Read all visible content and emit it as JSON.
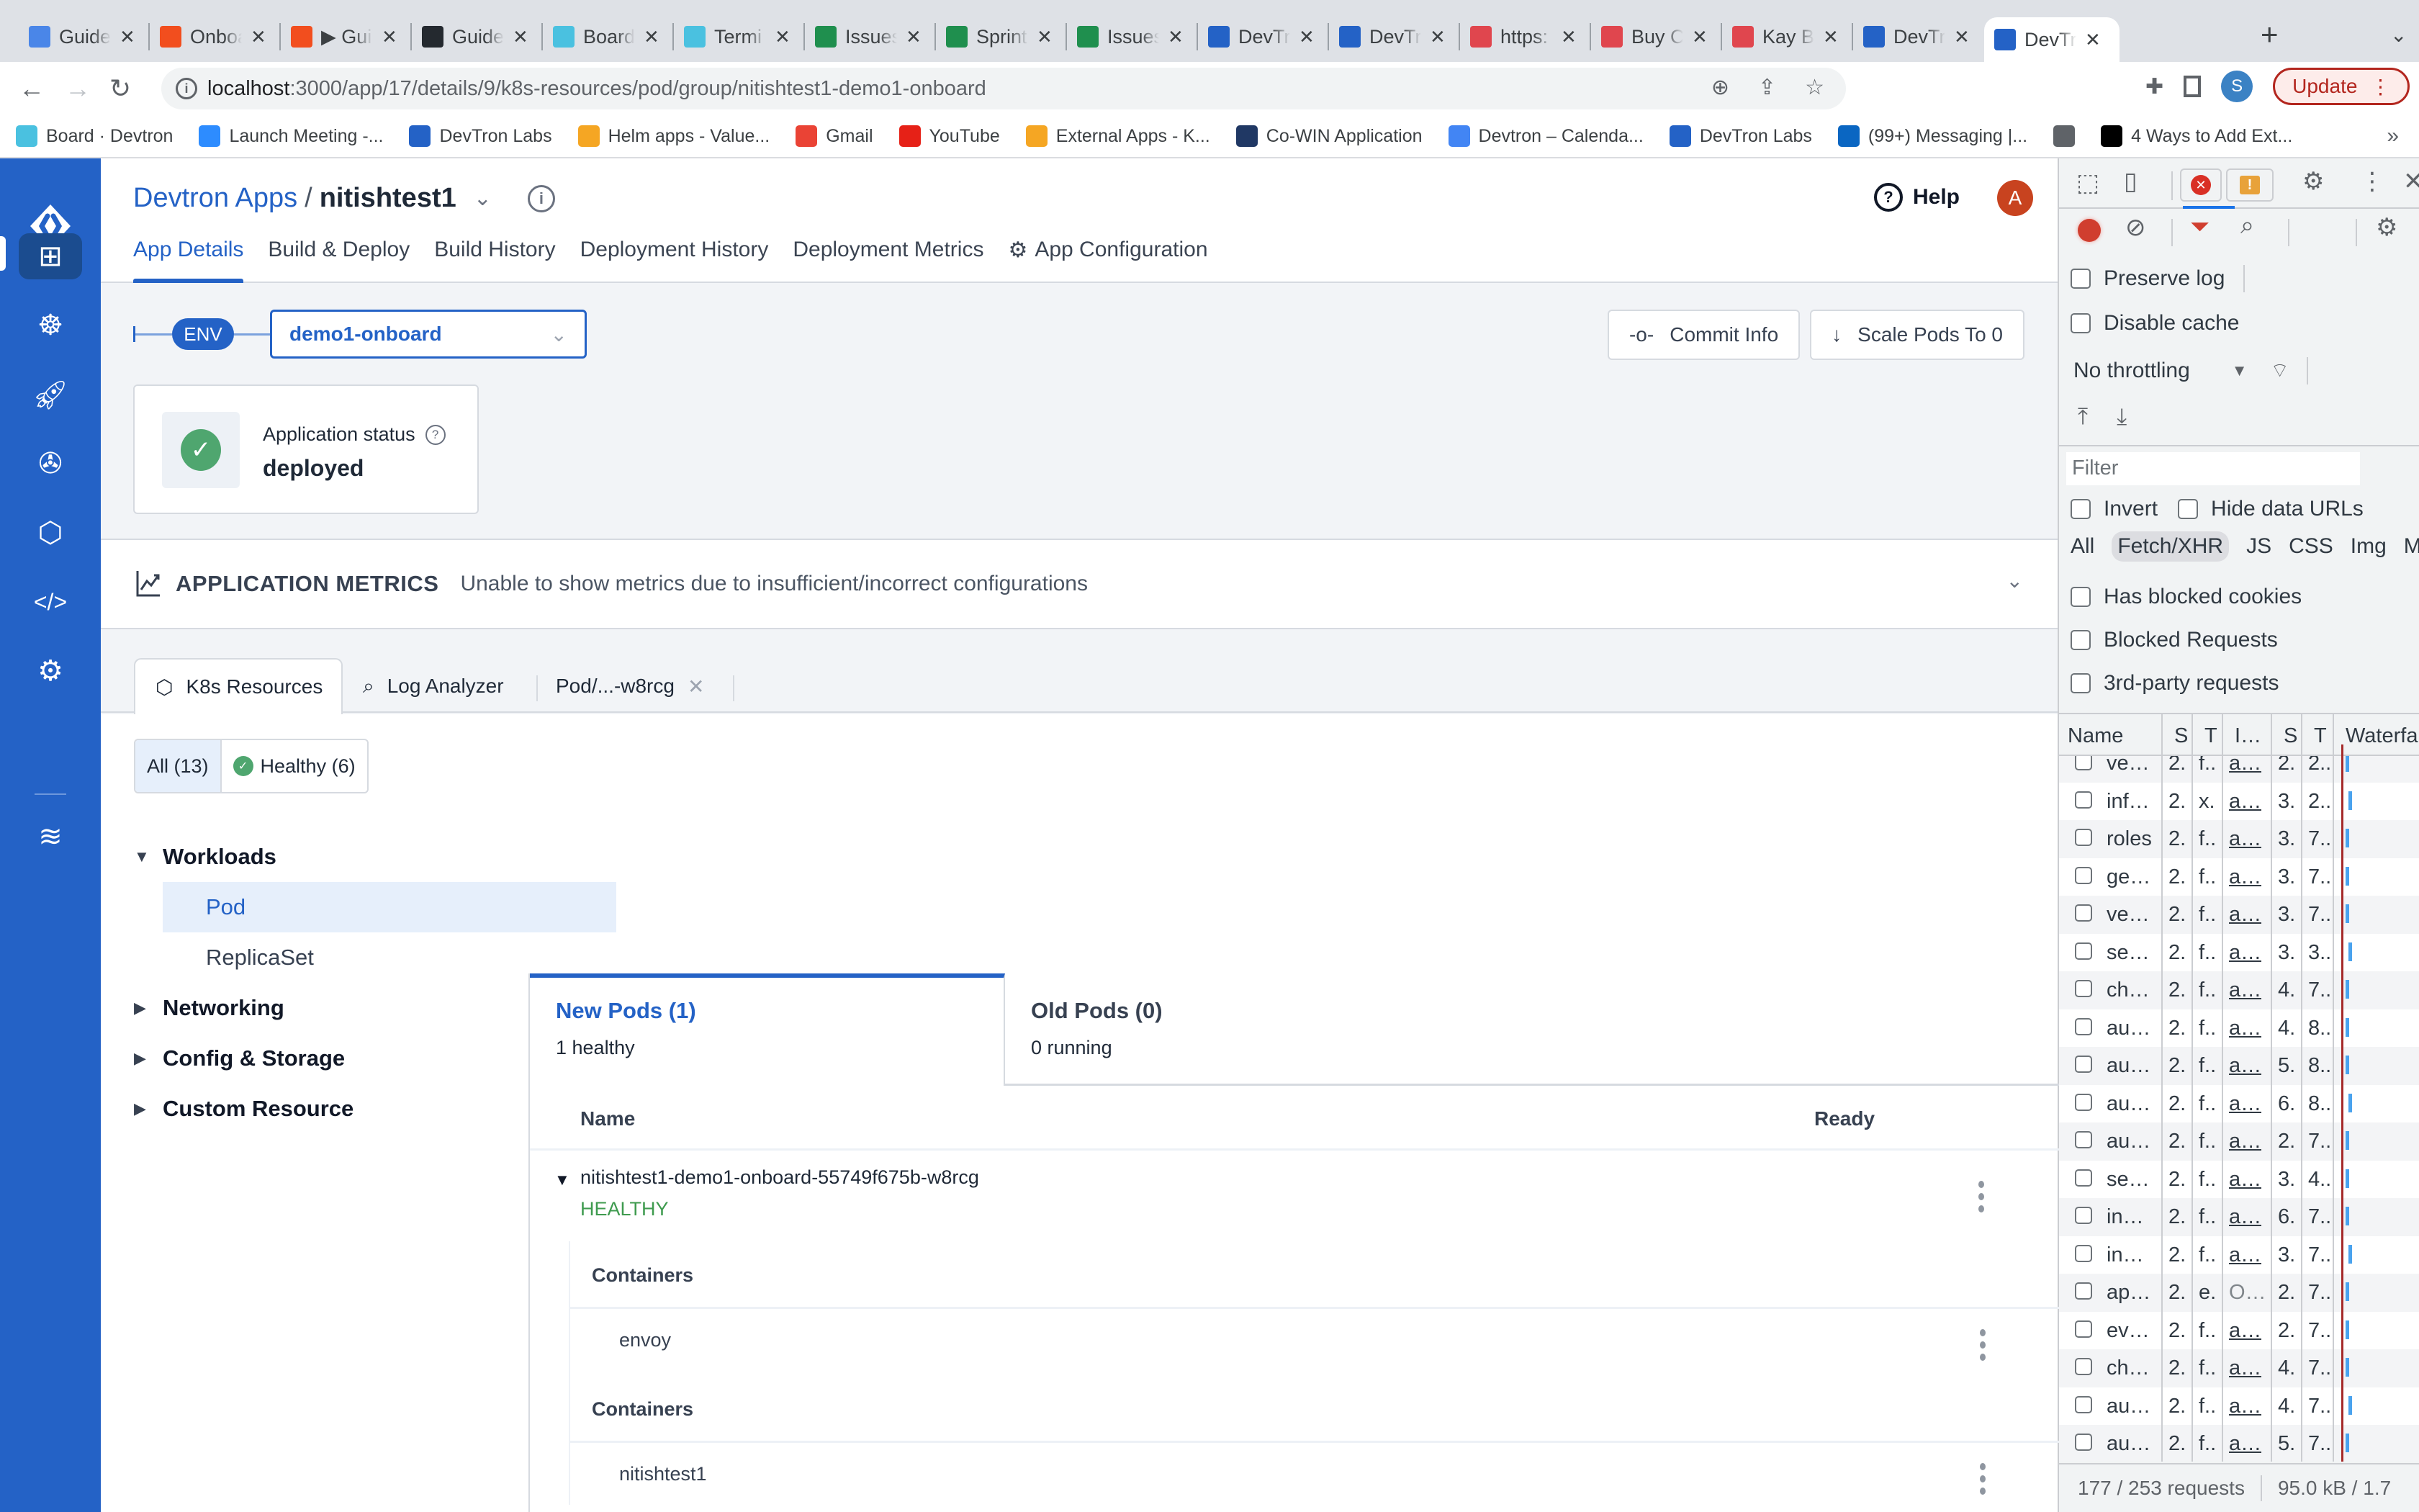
{
  "browser": {
    "tabs": [
      {
        "title": "Guide",
        "icon": "google-docs-icon",
        "color": "#4a86e8"
      },
      {
        "title": "Onboa",
        "icon": "figma-icon",
        "color": "#f24e1e"
      },
      {
        "title": "▶ Gui",
        "icon": "figma-icon",
        "color": "#f24e1e"
      },
      {
        "title": "Guide",
        "icon": "github-icon",
        "color": "#24292f"
      },
      {
        "title": "Board",
        "icon": "jira-icon",
        "color": "#4ac1e0"
      },
      {
        "title": "Termi",
        "icon": "jira-icon",
        "color": "#4ac1e0"
      },
      {
        "title": "Issues",
        "icon": "google-sheets-icon",
        "color": "#1f8f4e"
      },
      {
        "title": "Sprint",
        "icon": "google-sheets-icon",
        "color": "#1f8f4e"
      },
      {
        "title": "Issues",
        "icon": "google-sheets-icon",
        "color": "#1f8f4e"
      },
      {
        "title": "DevTr",
        "icon": "devtron-icon",
        "color": "#2462c6"
      },
      {
        "title": "DevTr",
        "icon": "devtron-icon",
        "color": "#2462c6"
      },
      {
        "title": "https:",
        "icon": "red-site-icon",
        "color": "#e0464e"
      },
      {
        "title": "Buy C",
        "icon": "red-site-icon",
        "color": "#e0464e"
      },
      {
        "title": "Kay B",
        "icon": "red-site-icon",
        "color": "#e0464e"
      },
      {
        "title": "DevTr",
        "icon": "devtron-icon",
        "color": "#2462c6"
      },
      {
        "title": "DevTr",
        "icon": "devtron-icon",
        "color": "#2462c6",
        "active": true
      }
    ],
    "url_host": "localhost",
    "url_rest": ":3000/app/17/details/9/k8s-resources/pod/group/nitishtest1-demo1-onboard",
    "profile_initial": "S",
    "update_label": "Update",
    "bookmarks": [
      {
        "label": "Board · Devtron",
        "icon": "jira-icon",
        "color": "#4ac1e0"
      },
      {
        "label": "Launch Meeting -...",
        "icon": "zoom-icon",
        "color": "#2d8cff"
      },
      {
        "label": "DevTron Labs",
        "icon": "devtron-icon",
        "color": "#2462c6"
      },
      {
        "label": "Helm apps - Value...",
        "icon": "helm-icon",
        "color": "#f5a623"
      },
      {
        "label": "Gmail",
        "icon": "gmail-icon",
        "color": "#ea4335"
      },
      {
        "label": "YouTube",
        "icon": "youtube-icon",
        "color": "#e62117"
      },
      {
        "label": "External Apps - K...",
        "icon": "helm-icon",
        "color": "#f5a623"
      },
      {
        "label": "Co-WIN Application",
        "icon": "cowin-icon",
        "color": "#203864"
      },
      {
        "label": "Devtron – Calenda...",
        "icon": "calendar-icon",
        "color": "#4285f4"
      },
      {
        "label": "DevTron Labs",
        "icon": "devtron-icon",
        "color": "#2462c6"
      },
      {
        "label": "(99+) Messaging |...",
        "icon": "linkedin-icon",
        "color": "#0a66c2"
      },
      {
        "label": "",
        "icon": "globe-icon",
        "color": "#5f6368"
      },
      {
        "label": "4 Ways to Add Ext...",
        "icon": "medium-icon",
        "color": "#000000"
      }
    ]
  },
  "nav": {
    "items": [
      "apps-grid-icon",
      "helm-wheel-icon",
      "rocket-icon",
      "bug-icon",
      "cubes-icon",
      "code-icon",
      "settings-icon",
      "stack-icon"
    ],
    "active": 0
  },
  "header": {
    "breadcrumb_root": "Devtron Apps",
    "separator": "/",
    "app_name": "nitishtest1",
    "help_label": "Help",
    "avatar_initial": "A",
    "tabs": [
      "App Details",
      "Build & Deploy",
      "Build History",
      "Deployment History",
      "Deployment Metrics",
      "App Configuration"
    ],
    "active_tab": 0
  },
  "env": {
    "label": "ENV",
    "selected": "demo1-onboard"
  },
  "actions": {
    "commit_info": "Commit Info",
    "scale_pods": "Scale Pods To 0"
  },
  "app_status": {
    "label": "Application status",
    "value": "deployed"
  },
  "metrics": {
    "title": "APPLICATION METRICS",
    "message": "Unable to show metrics due to insufficient/incorrect configurations"
  },
  "resource_tabs": [
    {
      "label": "K8s Resources",
      "icon": "cube-icon"
    },
    {
      "label": "Log Analyzer",
      "icon": "log-search-icon"
    },
    {
      "label": "Pod/...-w8rcg",
      "icon": "",
      "closable": true
    }
  ],
  "filters": {
    "all": "All (13)",
    "healthy": "Healthy (6)"
  },
  "tree": {
    "groups": [
      {
        "label": "Workloads",
        "expanded": true,
        "items": [
          "Pod",
          "ReplicaSet"
        ],
        "active_item": "Pod"
      },
      {
        "label": "Networking",
        "expanded": false
      },
      {
        "label": "Config & Storage",
        "expanded": false
      },
      {
        "label": "Custom Resource",
        "expanded": false
      }
    ]
  },
  "pods": {
    "new_tab": {
      "title": "New Pods (1)",
      "subtitle": "1 healthy"
    },
    "old_tab": {
      "title": "Old Pods (0)",
      "subtitle": "0 running"
    },
    "columns": [
      "Name",
      "Ready"
    ],
    "rows": [
      {
        "name": "nitishtest1-demo1-onboard-55749f675b-w8rcg",
        "status": "HEALTHY",
        "status_color": "#3f9b4f",
        "container_groups": [
          {
            "heading": "Containers",
            "name": "envoy"
          },
          {
            "heading": "Containers",
            "name": "nitishtest1"
          }
        ]
      }
    ]
  },
  "devtools": {
    "preserve_log": "Preserve log",
    "disable_cache": "Disable cache",
    "throttling": "No throttling",
    "filter_placeholder": "Filter",
    "invert": "Invert",
    "hide_data_urls": "Hide data URLs",
    "types": [
      "All",
      "Fetch/XHR",
      "JS",
      "CSS",
      "Img",
      "M"
    ],
    "selected_type": "Fetch/XHR",
    "has_blocked_cookies": "Has blocked cookies",
    "blocked_requests": "Blocked Requests",
    "third_party": "3rd-party requests",
    "columns": [
      "Name",
      "S",
      "T",
      "I…",
      "S",
      "T",
      "Waterfall"
    ],
    "rows": [
      [
        "ve…",
        "2.",
        "f..",
        "a…",
        "2.",
        "2.."
      ],
      [
        "inf…",
        "2.",
        "x.",
        "a…",
        "3.",
        "2.."
      ],
      [
        "roles",
        "2.",
        "f..",
        "a…",
        "3.",
        "7.."
      ],
      [
        "ge…",
        "2.",
        "f..",
        "a…",
        "3.",
        "7.."
      ],
      [
        "ve…",
        "2.",
        "f..",
        "a…",
        "3.",
        "7.."
      ],
      [
        "se…",
        "2.",
        "f..",
        "a…",
        "3.",
        "3.."
      ],
      [
        "ch…",
        "2.",
        "f..",
        "a…",
        "4.",
        "7.."
      ],
      [
        "au…",
        "2.",
        "f..",
        "a…",
        "4.",
        "8.."
      ],
      [
        "au…",
        "2.",
        "f..",
        "a…",
        "5.",
        "8.."
      ],
      [
        "au…",
        "2.",
        "f..",
        "a…",
        "6.",
        "8.."
      ],
      [
        "au…",
        "2.",
        "f..",
        "a…",
        "2.",
        "7.."
      ],
      [
        "se…",
        "2.",
        "f..",
        "a…",
        "3.",
        "4.."
      ],
      [
        "in…",
        "2.",
        "f..",
        "a…",
        "6.",
        "7.."
      ],
      [
        "in…",
        "2.",
        "f..",
        "a…",
        "3.",
        "7.."
      ],
      [
        "ap…",
        "2.",
        "e.",
        "O…",
        "2.",
        "7.."
      ],
      [
        "ev…",
        "2.",
        "f..",
        "a…",
        "2.",
        "7.."
      ],
      [
        "ch…",
        "2.",
        "f..",
        "a…",
        "4.",
        "7.."
      ],
      [
        "au…",
        "2.",
        "f..",
        "a…",
        "4.",
        "7.."
      ],
      [
        "au…",
        "2.",
        "f..",
        "a…",
        "5.",
        "7.."
      ]
    ],
    "requests_count": "177 / 253 requests",
    "transferred": "95.0 kB / 1.7"
  }
}
